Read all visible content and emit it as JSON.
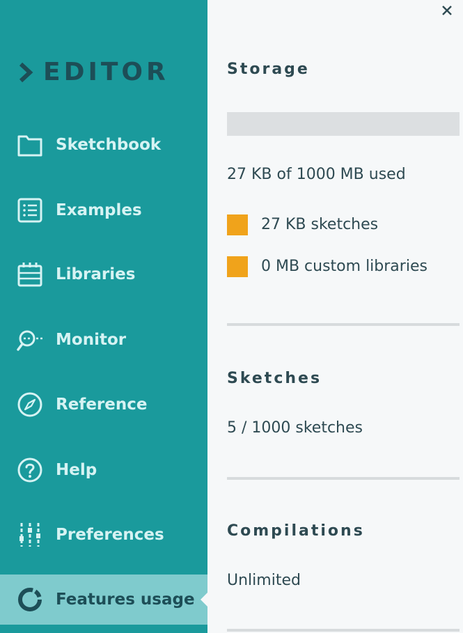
{
  "sidebar": {
    "brand": "EDITOR",
    "items": [
      {
        "label": "Sketchbook",
        "icon": "folder-icon"
      },
      {
        "label": "Examples",
        "icon": "list-icon"
      },
      {
        "label": "Libraries",
        "icon": "libraries-icon"
      },
      {
        "label": "Monitor",
        "icon": "monitor-search-icon"
      },
      {
        "label": "Reference",
        "icon": "compass-icon"
      },
      {
        "label": "Help",
        "icon": "help-icon"
      },
      {
        "label": "Preferences",
        "icon": "sliders-icon"
      },
      {
        "label": "Features usage",
        "icon": "usage-ring-icon"
      }
    ],
    "active_item": "Features usage"
  },
  "main": {
    "close_icon": "close-icon",
    "storage": {
      "title": "Storage",
      "used_fraction": 2.64e-05,
      "summary": "27 KB of 1000 MB used",
      "legend": [
        {
          "label": "27 KB sketches",
          "color": "#f0a31b"
        },
        {
          "label": "0 MB custom libraries",
          "color": "#f0a31b"
        }
      ]
    },
    "sketches": {
      "title": "Sketches",
      "summary": "5 / 1000 sketches"
    },
    "compilations": {
      "title": "Compilations",
      "summary": "Unlimited"
    }
  },
  "colors": {
    "sidebar_bg": "#1a9a9c",
    "active_bg": "#7fcbcd",
    "accent": "#f0a31b",
    "text_dark": "#2e4a52",
    "nav_text": "#d6f3f3"
  }
}
